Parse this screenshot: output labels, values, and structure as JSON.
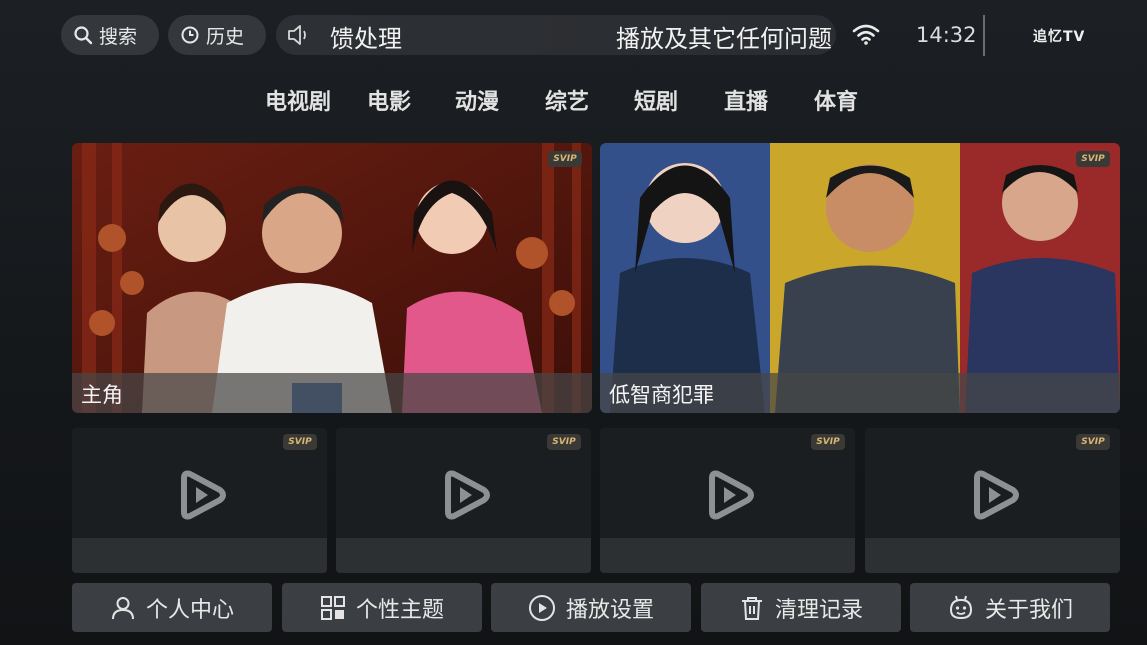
{
  "top": {
    "search_label": "搜索",
    "history_label": "历史",
    "notice_visible_left": "馈处理",
    "notice_visible_right": "播放及其它任何问题",
    "time": "14:32",
    "brand": "追忆TV"
  },
  "nav": {
    "tabs": [
      {
        "label": "电视剧"
      },
      {
        "label": "电影"
      },
      {
        "label": "动漫"
      },
      {
        "label": "综艺"
      },
      {
        "label": "短剧"
      },
      {
        "label": "直播"
      },
      {
        "label": "体育"
      }
    ]
  },
  "featured": [
    {
      "title": "主角",
      "badge": "SVIP"
    },
    {
      "title": "低智商犯罪",
      "badge": "SVIP"
    }
  ],
  "placeholders": [
    {
      "badge": "SVIP"
    },
    {
      "badge": "SVIP"
    },
    {
      "badge": "SVIP"
    },
    {
      "badge": "SVIP"
    }
  ],
  "bottom": {
    "items": [
      {
        "label": "个人中心",
        "icon": "person-icon"
      },
      {
        "label": "个性主题",
        "icon": "grid-icon"
      },
      {
        "label": "播放设置",
        "icon": "play-circle-icon"
      },
      {
        "label": "清理记录",
        "icon": "trash-icon"
      },
      {
        "label": "关于我们",
        "icon": "smiley-icon"
      }
    ]
  },
  "colors": {
    "background": "#1a1d20",
    "pill": "#34373b",
    "svip_gold": "#d7b676",
    "button": "#3b3e42"
  }
}
